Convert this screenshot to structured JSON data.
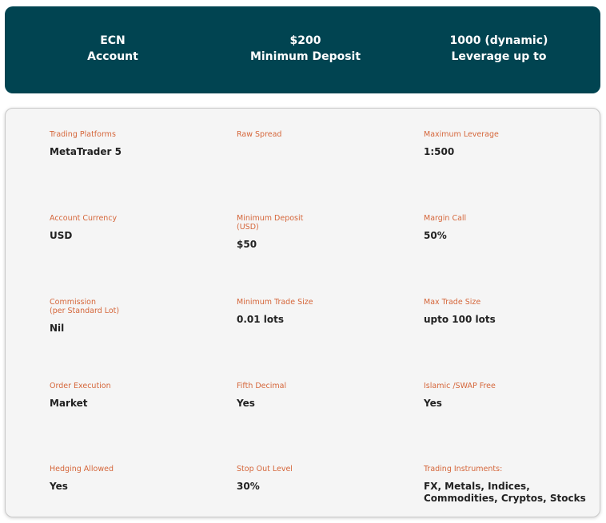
{
  "header": {
    "col1_line1": "ECN",
    "col1_line2": "Account",
    "col2_line1": "$200",
    "col2_line2": "Minimum Deposit",
    "col3_line1": "1000 (dynamic)",
    "col3_line2": "Leverage up to"
  },
  "specs": {
    "trading_platforms": {
      "label": "Trading Platforms",
      "value": "MetaTrader 5"
    },
    "raw_spread": {
      "label": "Raw Spread",
      "value": ""
    },
    "max_leverage": {
      "label": "Maximum Leverage",
      "value": "1:500"
    },
    "account_currency": {
      "label": "Account Currency",
      "value": "USD"
    },
    "min_deposit": {
      "label_line1": "Minimum Deposit",
      "label_line2": "(USD)",
      "value": "$50"
    },
    "margin_call": {
      "label": "Margin Call",
      "value": "50%"
    },
    "commission": {
      "label_line1": "Commission",
      "label_line2": "(per Standard Lot)",
      "value": "Nil"
    },
    "min_trade_size": {
      "label": "Minimum Trade Size",
      "value": "0.01 lots"
    },
    "max_trade_size": {
      "label": "Max Trade Size",
      "value": "upto 100 lots"
    },
    "order_execution": {
      "label": "Order Execution",
      "value": "Market"
    },
    "fifth_decimal": {
      "label": "Fifth Decimal",
      "value": "Yes"
    },
    "islamic_swap_free": {
      "label": "Islamic /SWAP Free",
      "value": "Yes"
    },
    "hedging_allowed": {
      "label": "Hedging Allowed",
      "value": "Yes"
    },
    "stop_out_level": {
      "label": "Stop Out Level",
      "value": "30%"
    },
    "trading_instruments": {
      "label": "Trading Instruments:",
      "value_line1": "FX, Metals, Indices,",
      "value_line2": "Commodities, Cryptos, Stocks"
    }
  },
  "colors": {
    "header_bg": "#014451",
    "label": "#d5663a",
    "value": "#222222",
    "card_bg": "#f5f5f5"
  }
}
